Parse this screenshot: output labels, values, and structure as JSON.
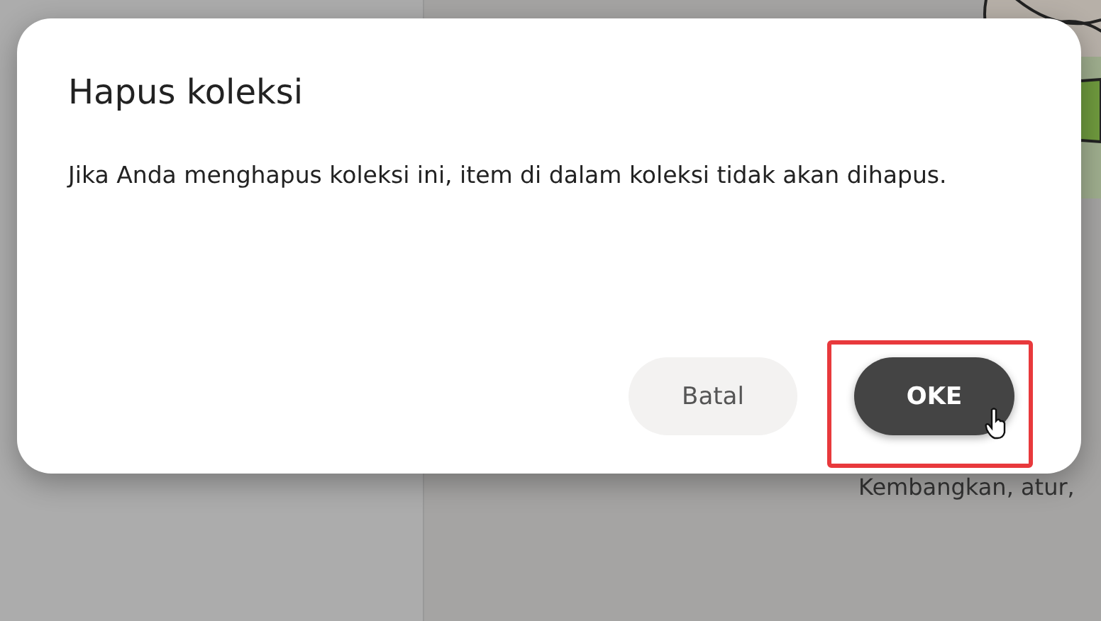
{
  "background": {
    "caption": "Kembangkan, atur,"
  },
  "dialog": {
    "title": "Hapus koleksi",
    "message": "Jika Anda menghapus koleksi ini, item di dalam koleksi tidak akan dihapus.",
    "buttons": [
      {
        "label": "Batal",
        "kind": "secondary",
        "highlighted": false
      },
      {
        "label": "OKE",
        "kind": "primary",
        "highlighted": true
      }
    ]
  }
}
